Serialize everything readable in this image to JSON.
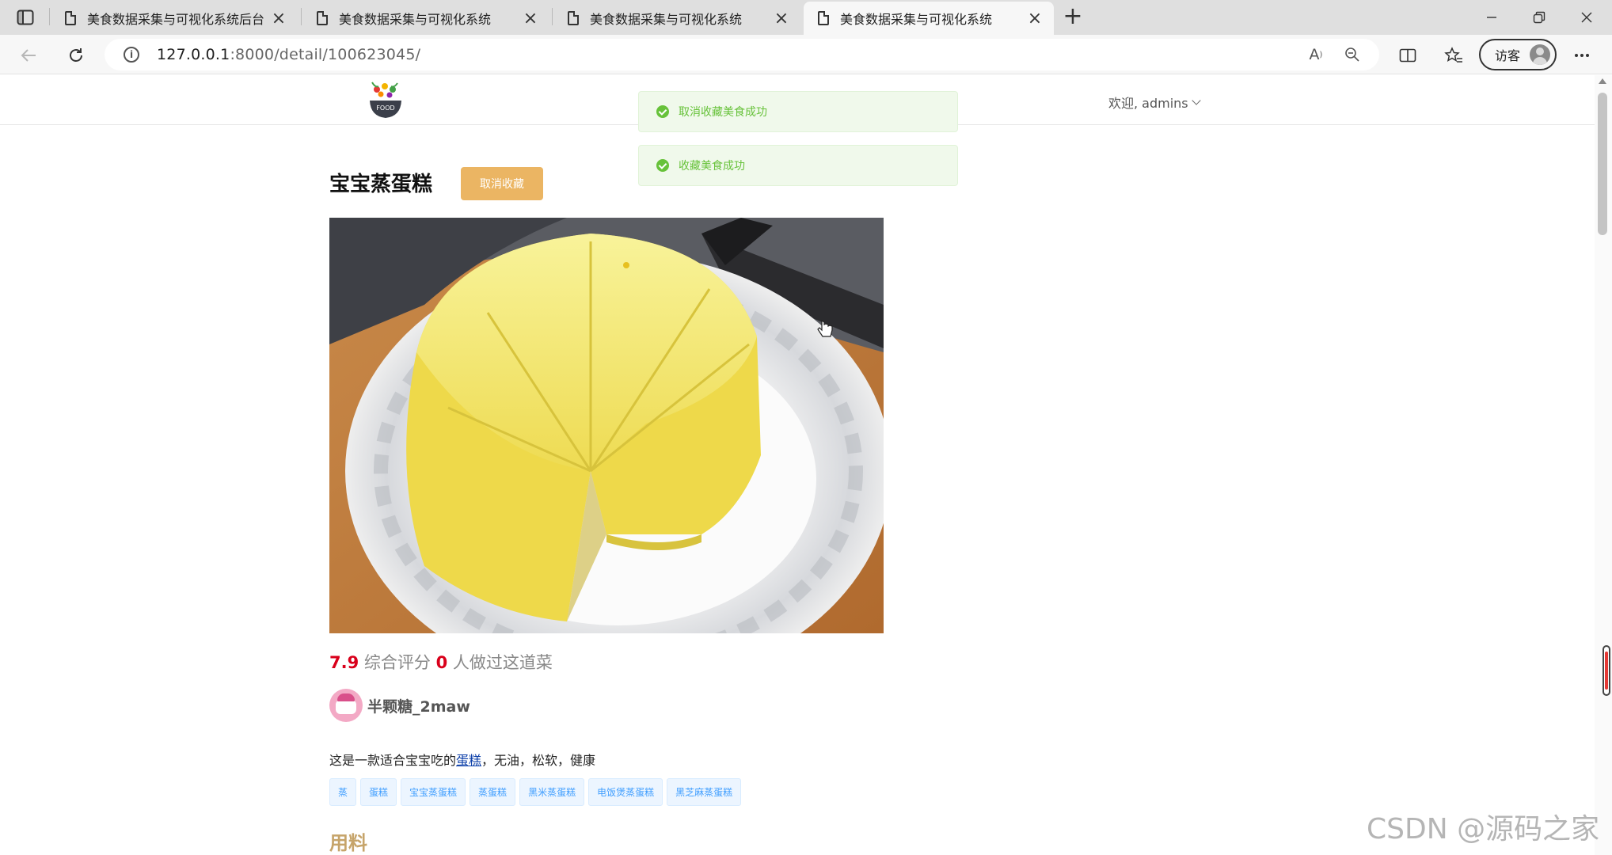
{
  "browser": {
    "tabs": [
      {
        "title": "美食数据采集与可视化系统后台",
        "active": false
      },
      {
        "title": "美食数据采集与可视化系统",
        "active": false
      },
      {
        "title": "美食数据采集与可视化系统",
        "active": false
      },
      {
        "title": "美食数据采集与可视化系统",
        "active": true
      }
    ],
    "url_host": "127.0.0.1",
    "url_path": ":8000/detail/100623045/",
    "guest_label": "访客"
  },
  "header": {
    "logo_text": "FOOD",
    "user_greeting": "欢迎, admins"
  },
  "toasts": [
    {
      "message": "取消收藏美食成功"
    },
    {
      "message": "收藏美食成功"
    }
  ],
  "detail": {
    "title": "宝宝蒸蛋糕",
    "fav_button": "取消收藏",
    "score": "7.9",
    "score_label": "综合评分",
    "made_count": "0",
    "made_label": "人做过这道菜",
    "author": "半颗糖_2maw",
    "desc_before": "这是一款适合宝宝吃的",
    "desc_link": "蛋糕",
    "desc_after": "，无油，松软，健康",
    "tags": [
      "蒸",
      "蛋糕",
      "宝宝蒸蛋糕",
      "蒸蛋糕",
      "黑米蒸蛋糕",
      "电饭煲蒸蛋糕",
      "黑芝麻蒸蛋糕"
    ],
    "ingredients_title": "用料"
  },
  "watermark": "CSDN @源码之家"
}
